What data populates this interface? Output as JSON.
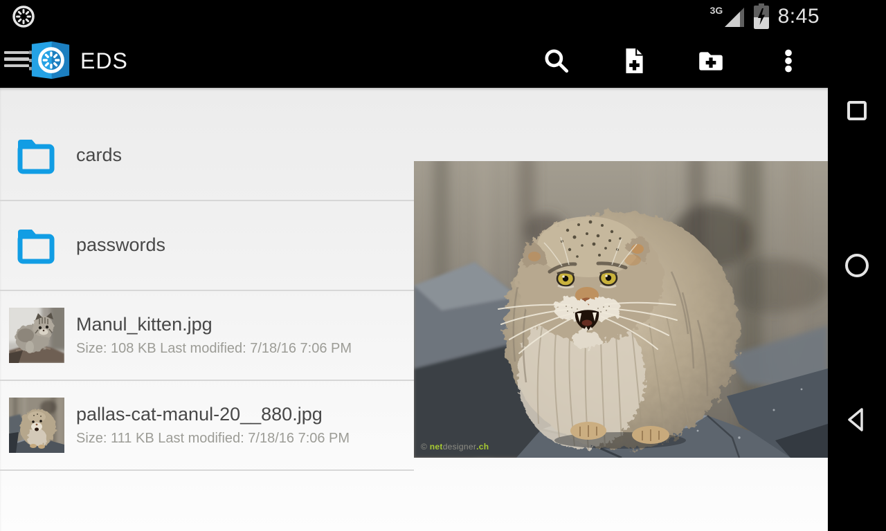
{
  "status_bar": {
    "network_type": "3G",
    "time": "8:45",
    "icons": {
      "notification": "eds-dial-icon",
      "signal": "signal-strength-icon",
      "battery": "battery-charging-icon"
    }
  },
  "app_bar": {
    "title": "EDS",
    "icons": {
      "menu": "hamburger-menu-icon",
      "logo": "eds-safe-logo",
      "search": "search-icon",
      "new_file": "new-file-icon",
      "new_folder": "new-folder-icon",
      "more": "overflow-menu-icon"
    }
  },
  "file_list": {
    "items": [
      {
        "type": "folder",
        "label": "cards"
      },
      {
        "type": "folder",
        "label": "passwords"
      },
      {
        "type": "image-file",
        "label": "Manul_kitten.jpg",
        "details": "Size: 108 KB Last modified: 7/18/16 7:06 PM"
      },
      {
        "type": "image-file",
        "label": "pallas-cat-manul-20__880.jpg",
        "details": "Size: 111 KB Last modified: 7/18/16 7:06 PM"
      }
    ]
  },
  "preview": {
    "watermark": {
      "copyright": "© ",
      "net": "net",
      "designer": "designer",
      "ch": ".ch"
    }
  },
  "nav_bar": {
    "icons": [
      "recents-square-icon",
      "home-circle-icon",
      "back-triangle-icon"
    ]
  },
  "colors": {
    "accent_blue": "#119de4",
    "logo_blue_light": "#25a2e5",
    "logo_blue_dark": "#1c7fc0",
    "list_title": "#484848",
    "list_subtitle": "#9c9c96",
    "divider": "#d7d7d7",
    "watermark_green": "#a8cb32",
    "bar_background": "#000000"
  }
}
